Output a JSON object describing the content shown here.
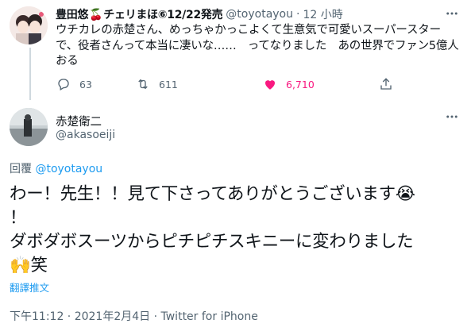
{
  "parent_tweet": {
    "display_name": "豊田悠",
    "cherry_emoji": "🍒",
    "display_name_suffix": "チェリまほ⑥12/22発売",
    "handle": "@toyotayou",
    "separator": "·",
    "time": "12 小時",
    "text": "ウチカレの赤楚さん、めっちゃかっこよくて生意気で可愛いスーパースターで、役者さんって本当に凄いな……　ってなりました　あの世界でファン5億人おる",
    "reply_count": "63",
    "retweet_count": "611",
    "like_count": "6,710"
  },
  "main_tweet": {
    "display_name": "赤楚衛二",
    "handle": "@akasoeiji",
    "reply_label": "回覆",
    "reply_mention": "@toyotayou",
    "text_line1": "わー！先生！！見て下さってありがとうございます😭",
    "text_line2": "！",
    "text_line3": "ダボダボスーツからピチピチスキニーに変わりました",
    "text_line4": "🙌笑",
    "translate_label": "翻譯推文",
    "timestamp": "下午11:12 · 2021年2月4日 · ",
    "source": "Twitter for iPhone"
  },
  "colors": {
    "text_primary": "#0f1419",
    "text_secondary": "#536471",
    "link_blue": "#1d9bf0",
    "like_pink": "#f91880",
    "thread_line": "#cfd9de"
  }
}
